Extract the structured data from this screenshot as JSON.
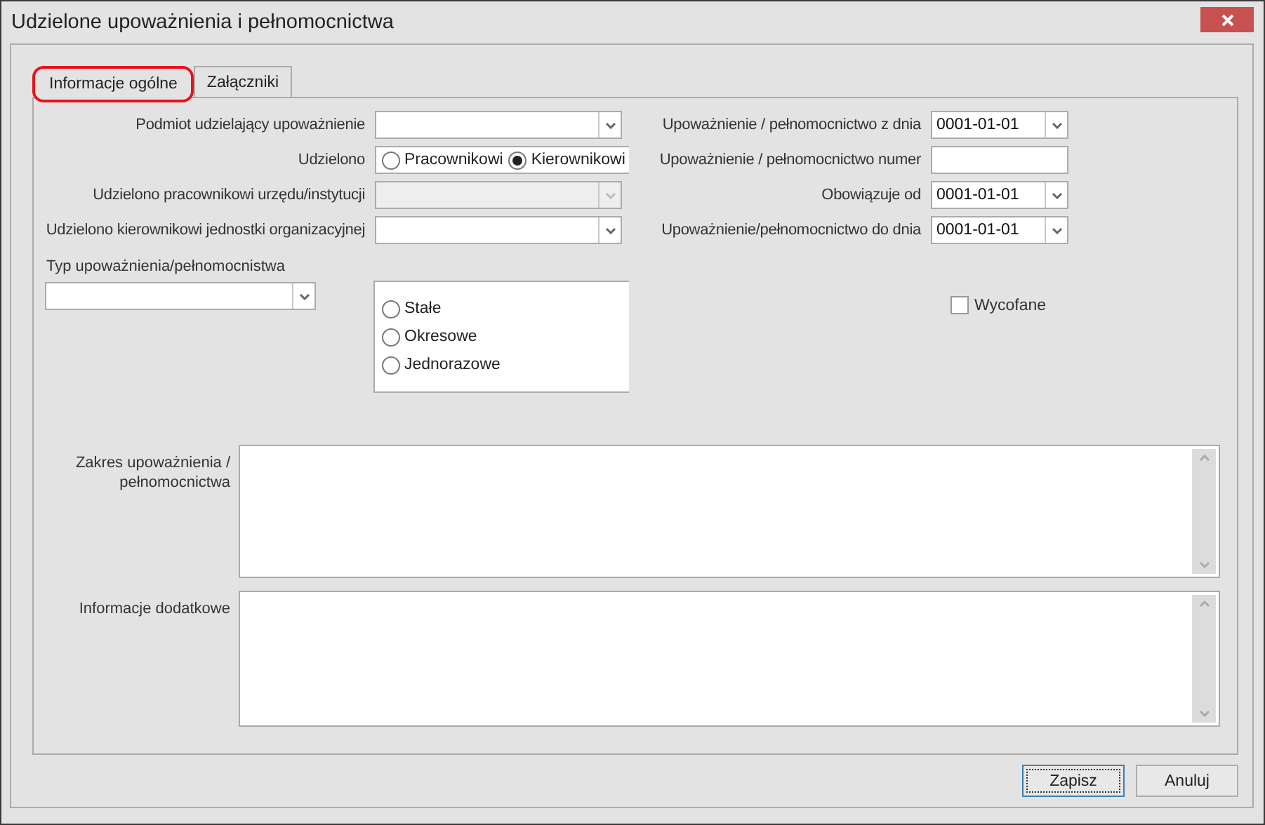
{
  "window": {
    "title": "Udzielone upoważnienia i pełnomocnictwa"
  },
  "tabs": [
    {
      "label": "Informacje ogólne",
      "selected": true
    },
    {
      "label": "Załączniki",
      "selected": false
    }
  ],
  "fields_left": [
    {
      "kind": "combo",
      "label": "Podmiot udzielający upoważnienie",
      "disabled": false
    },
    {
      "kind": "radio",
      "label": "Udzielono",
      "options": [
        {
          "label": "Pracownikowi",
          "selected": false
        },
        {
          "label": "Kierownikowi",
          "selected": true
        }
      ]
    },
    {
      "kind": "combo",
      "label": "Udzielono pracownikowi urzędu/instytucji",
      "disabled": true
    },
    {
      "kind": "combo",
      "label": "Udzielono kierownikowi jednostki organizacyjnej",
      "disabled": false
    }
  ],
  "fields_right": [
    {
      "kind": "date",
      "label": "Upoważnienie / pełnomocnictwo z dnia",
      "value": "0001-01-01"
    },
    {
      "kind": "text",
      "label": "Upoważnienie / pełnomocnictwo numer"
    },
    {
      "kind": "date",
      "label": "Obowiązuje od",
      "value": "0001-01-01"
    },
    {
      "kind": "date",
      "label": "Upoważnienie/pełnomocnictwo do dnia",
      "value": "0001-01-01"
    }
  ],
  "type_field": {
    "label": "Typ upoważnienia/pełnomocnistwa"
  },
  "type_options": [
    {
      "label": "Stałe",
      "selected": false
    },
    {
      "label": "Okresowe",
      "selected": false
    },
    {
      "label": "Jednorazowe",
      "selected": false
    }
  ],
  "withdrawn": {
    "label": "Wycofane",
    "checked": false
  },
  "text_areas": [
    {
      "label": "Zakres upoważnienia / pełnomocnictwa"
    },
    {
      "label": "Informacje dodatkowe"
    }
  ],
  "buttons": [
    {
      "label": "Zapisz",
      "focused": true
    },
    {
      "label": "Anuluj",
      "focused": false
    }
  ]
}
